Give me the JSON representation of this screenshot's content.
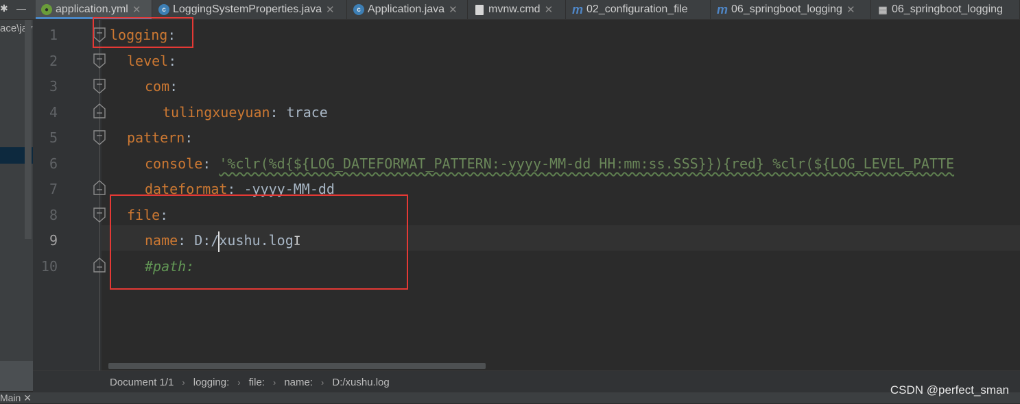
{
  "tabs": [
    {
      "icon": "spring-yaml-icon",
      "label": "application.yml",
      "active": true
    },
    {
      "icon": "class-icon",
      "label": "LoggingSystemProperties.java"
    },
    {
      "icon": "class-icon",
      "label": "Application.java"
    },
    {
      "icon": "file-icon",
      "label": "mvnw.cmd"
    },
    {
      "icon": "maven-icon",
      "label": "02_configuration_file"
    },
    {
      "icon": "maven-icon",
      "label": "06_springboot_logging"
    },
    {
      "icon": "project-structure-icon",
      "label": "06_springboot_logging"
    }
  ],
  "project_panel": {
    "path_fragment": "ace\\jav"
  },
  "editor": {
    "line_numbers": [
      "1",
      "2",
      "3",
      "4",
      "5",
      "6",
      "7",
      "8",
      "9",
      "10"
    ],
    "current_line": "9",
    "lines": {
      "l1_key": "logging",
      "l2_key": "level",
      "l3_key": "com",
      "l4_key": "tulingxueyuan",
      "l4_value": "trace",
      "l5_key": "pattern",
      "l6_key": "console",
      "l6_value": "'%clr(%d{${LOG_DATEFORMAT_PATTERN:-yyyy-MM-dd HH:mm:ss.SSS}}){red} %clr(${LOG_LEVEL_PATTE",
      "l7_key": "dateformat",
      "l7_value": "-yyyy-MM-dd",
      "l8_key": "file",
      "l9_key": "name",
      "l9_value_before_caret": "D:/",
      "l9_value_after_caret": "xushu.log",
      "l10_comment": "#path:"
    },
    "colon": ":"
  },
  "breadcrumb": [
    "Document 1/1",
    "logging:",
    "file:",
    "name:",
    "D:/xushu.log"
  ],
  "status": {
    "run_tab": "Main"
  },
  "watermark": "CSDN @perfect_sman",
  "colors": {
    "keyword": "#cc7832",
    "string": "#6a8759",
    "comment": "#629755",
    "highlight": "#e53935",
    "active_tab": "#4a88c7"
  }
}
